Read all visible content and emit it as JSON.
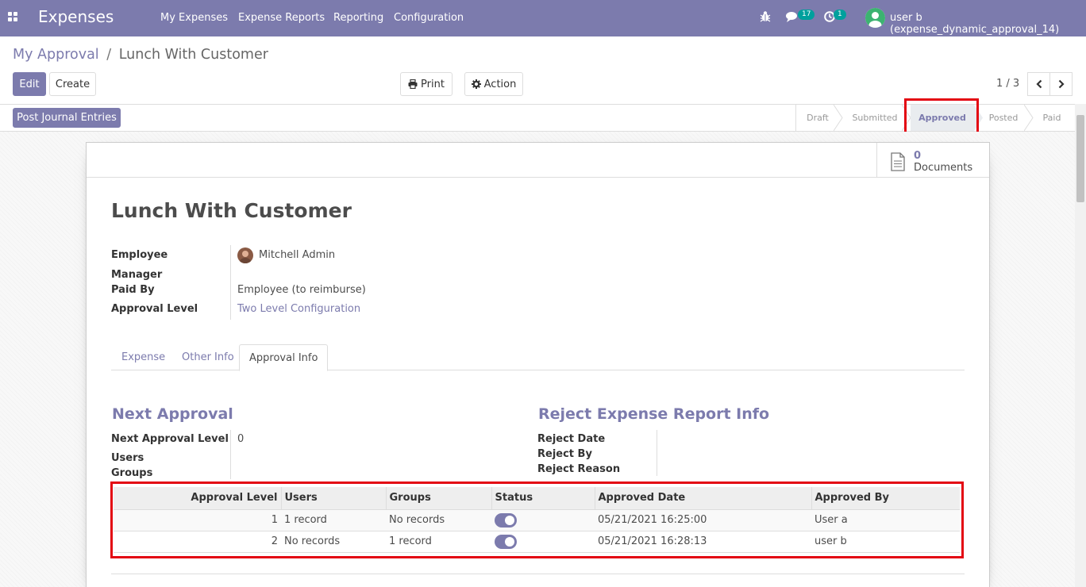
{
  "navbar": {
    "brand": "Expenses",
    "menu": [
      "My Expenses",
      "Expense Reports",
      "Reporting",
      "Configuration"
    ],
    "messages_count": "17",
    "activities_count": "1",
    "user": "user b (expense_dynamic_approval_14)",
    "bg_color": "#7c7bad"
  },
  "breadcrumb": {
    "parent": "My Approval",
    "separator": "/",
    "current": "Lunch With Customer"
  },
  "buttons": {
    "edit": "Edit",
    "create": "Create",
    "print": "Print",
    "action": "Action",
    "post_journal": "Post Journal Entries"
  },
  "pager": {
    "value": "1 / 3"
  },
  "statusbar": {
    "stages": [
      "Draft",
      "Submitted",
      "Approved",
      "Posted",
      "Paid"
    ],
    "active": "Approved"
  },
  "smart_button": {
    "count": "0",
    "label": "Documents"
  },
  "form": {
    "title": "Lunch With Customer",
    "fields": {
      "employee_label": "Employee",
      "employee_value": "Mitchell Admin",
      "manager_label": "Manager",
      "paid_by_label": "Paid By",
      "paid_by_value": "Employee (to reimburse)",
      "approval_level_label": "Approval Level",
      "approval_level_value": "Two Level Configuration"
    },
    "tabs": [
      "Expense",
      "Other Info",
      "Approval Info"
    ],
    "active_tab": "Approval Info",
    "next_approval": {
      "title": "Next Approval",
      "level_label": "Next Approval Level",
      "level_value": "0",
      "users_label": "Users",
      "groups_label": "Groups"
    },
    "reject_info": {
      "title": "Reject Expense Report Info",
      "date_label": "Reject Date",
      "by_label": "Reject By",
      "reason_label": "Reject Reason"
    },
    "approval_table": {
      "headers": [
        "Approval Level",
        "Users",
        "Groups",
        "Status",
        "Approved Date",
        "Approved By"
      ],
      "rows": [
        {
          "level": "1",
          "users": "1 record",
          "groups": "No records",
          "status": true,
          "date": "05/21/2021 16:25:00",
          "by": "User a"
        },
        {
          "level": "2",
          "users": "No records",
          "groups": "1 record",
          "status": true,
          "date": "05/21/2021 16:28:13",
          "by": "user b"
        }
      ]
    }
  },
  "highlight_color": "#e30613"
}
